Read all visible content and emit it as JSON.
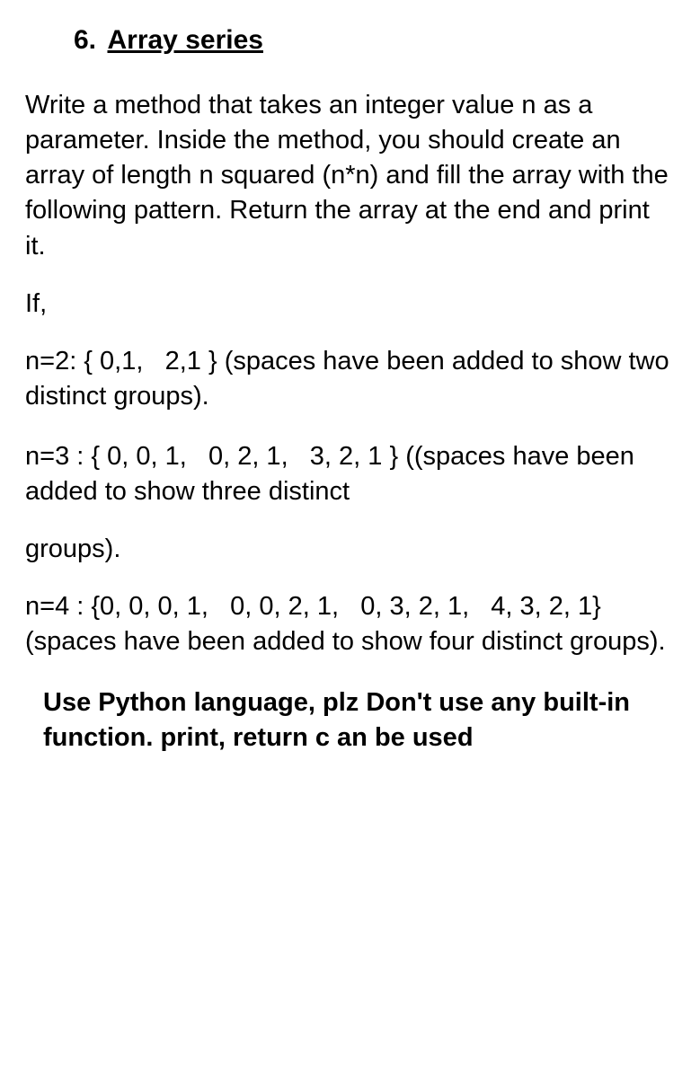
{
  "heading": {
    "number": "6.",
    "title": "Array series"
  },
  "paragraphs": {
    "intro": "Write a method that takes an integer value n as a parameter. Inside the method, you should create an array of length n squared (n*n) and fill the array with the following pattern. Return the array at the end and print it.",
    "if_label": "If,",
    "n2": "n=2: { 0,1,   2,1 } (spaces have been added to show two distinct groups).",
    "n3": "n=3 : { 0, 0, 1,   0, 2, 1,   3, 2, 1 } ((spaces have been added to show three distinct",
    "groups_label": "groups).",
    "n4": "n=4 : {0, 0, 0, 1,   0, 0, 2, 1,   0, 3, 2, 1,   4, 3, 2, 1}  (spaces have been added to show four distinct groups).",
    "note": "Use Python language, plz Don't use any built-in function. print, return c an be used"
  }
}
